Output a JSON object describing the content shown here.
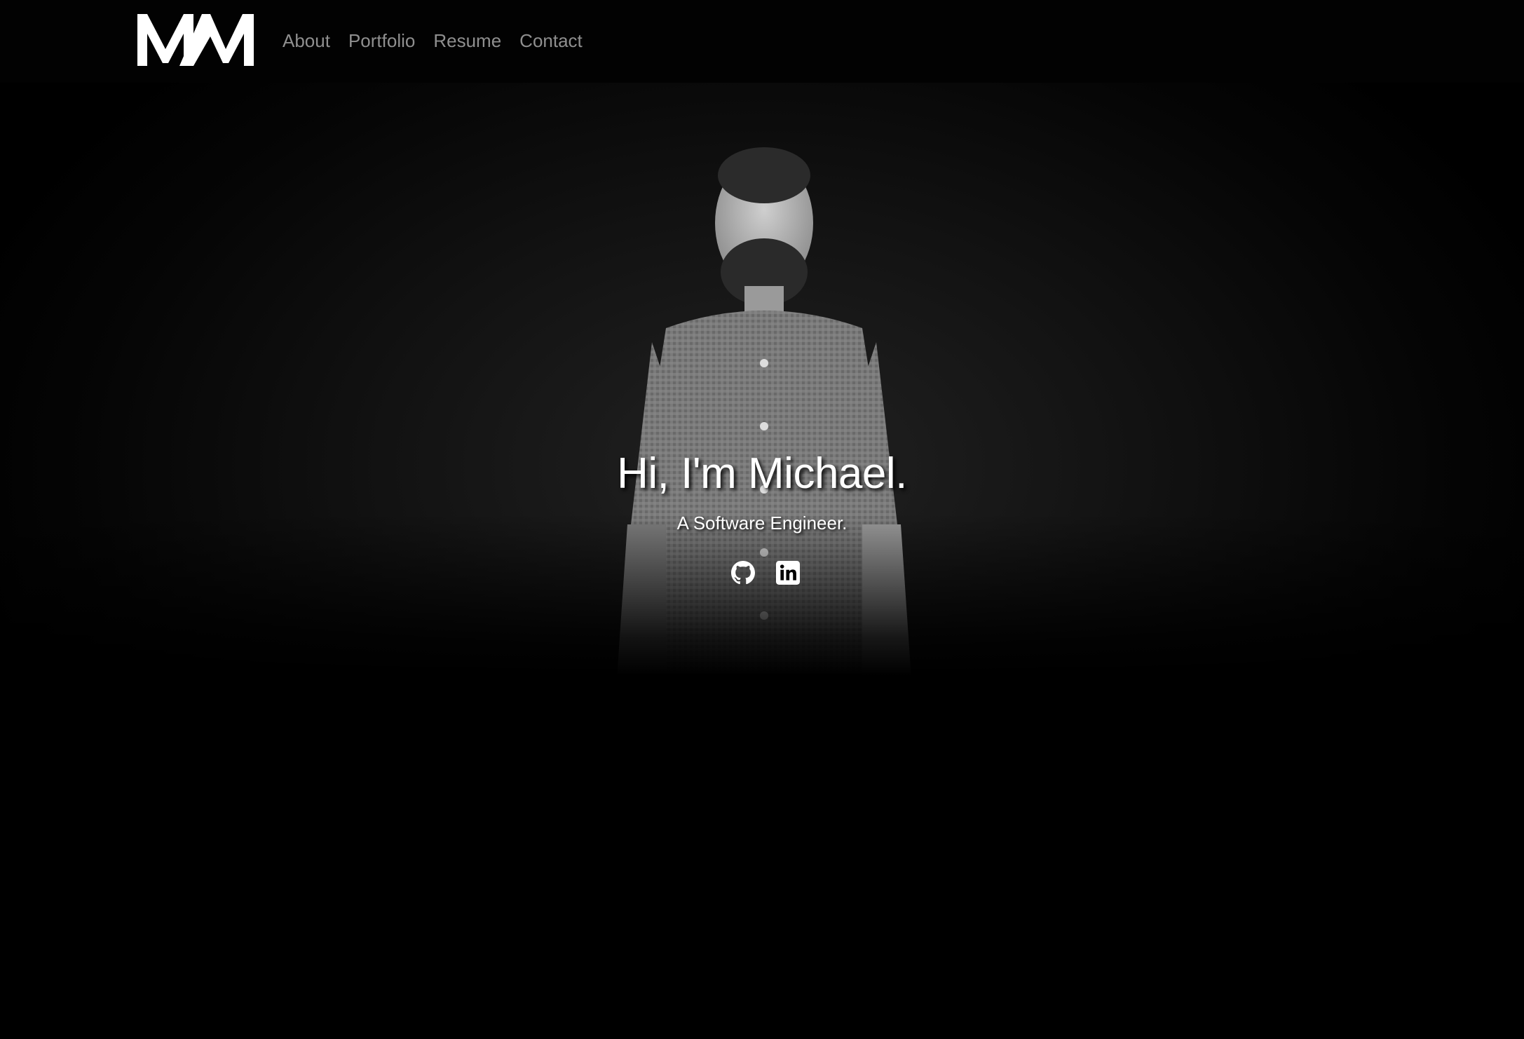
{
  "header": {
    "logo_text": "MM",
    "nav": [
      {
        "label": "About"
      },
      {
        "label": "Portfolio"
      },
      {
        "label": "Resume"
      },
      {
        "label": "Contact"
      }
    ]
  },
  "hero": {
    "title": "Hi, I'm Michael.",
    "subtitle": "A Software Engineer.",
    "social": [
      {
        "icon": "github-icon"
      },
      {
        "icon": "linkedin-icon"
      }
    ]
  },
  "colors": {
    "background": "#000000",
    "nav_text": "#8f8f8f",
    "hero_text": "#ffffff"
  }
}
